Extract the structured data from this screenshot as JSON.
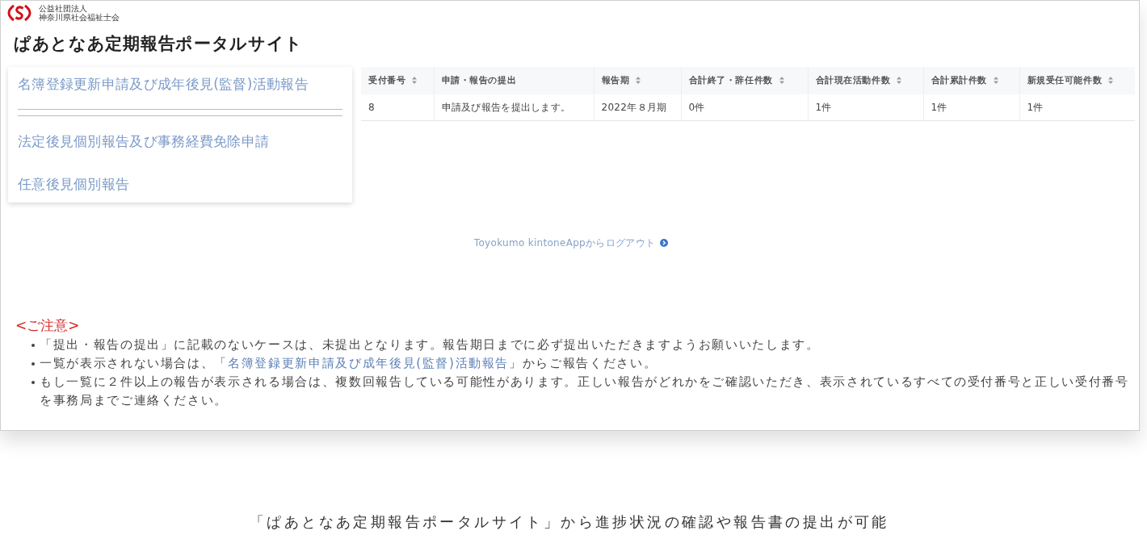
{
  "logo": {
    "org_type": "公益社団法人",
    "org_name": "神奈川県社会福祉士会"
  },
  "page_title": "ぱあとなあ定期報告ポータルサイト",
  "menu": {
    "groups": [
      [
        {
          "label": "名簿登録更新申請及び成年後見(監督)活動報告"
        }
      ],
      [
        {
          "label": "法定後見個別報告及び事務経費免除申請"
        },
        {
          "label": "任意後見個別報告"
        }
      ]
    ]
  },
  "table": {
    "columns": [
      {
        "label": "受付番号",
        "sortable": true
      },
      {
        "label": "申請・報告の提出",
        "sortable": false
      },
      {
        "label": "報告期",
        "sortable": true
      },
      {
        "label": "合計終了・辞任件数",
        "sortable": true
      },
      {
        "label": "合計現在活動件数",
        "sortable": true
      },
      {
        "label": "合計累計件数",
        "sortable": true
      },
      {
        "label": "新規受任可能件数",
        "sortable": true
      }
    ],
    "rows": [
      [
        "8",
        "申請及び報告を提出します。",
        "2022年８月期",
        "0件",
        "1件",
        "1件",
        "1件"
      ]
    ]
  },
  "logout_link": "Toyokumo kintoneAppからログアウト",
  "notice": {
    "heading": "<ご注意>",
    "items": [
      {
        "parts": [
          {
            "kind": "text",
            "text": "「提出・報告の提出」に記載のないケースは、未提出となります。報告期日までに必ず提出いただきますようお願いいたします。"
          }
        ]
      },
      {
        "parts": [
          {
            "kind": "text",
            "text": "一覧が表示されない場合は、「"
          },
          {
            "kind": "link",
            "text": "名簿登録更新申請及び成年後見(監督)活動報告"
          },
          {
            "kind": "text",
            "text": "」からご報告ください。"
          }
        ]
      },
      {
        "parts": [
          {
            "kind": "text",
            "text": "もし一覧に２件以上の報告が表示される場合は、複数回報告している可能性があります。正しい報告がどれかをご確認いただき、表示されているすべての受付番号と正しい受付番号を事務局までご連絡ください。"
          }
        ]
      }
    ]
  },
  "caption": "「ぱあとなあ定期報告ポータルサイト」から進捗状況の確認や報告書の提出が可能"
}
